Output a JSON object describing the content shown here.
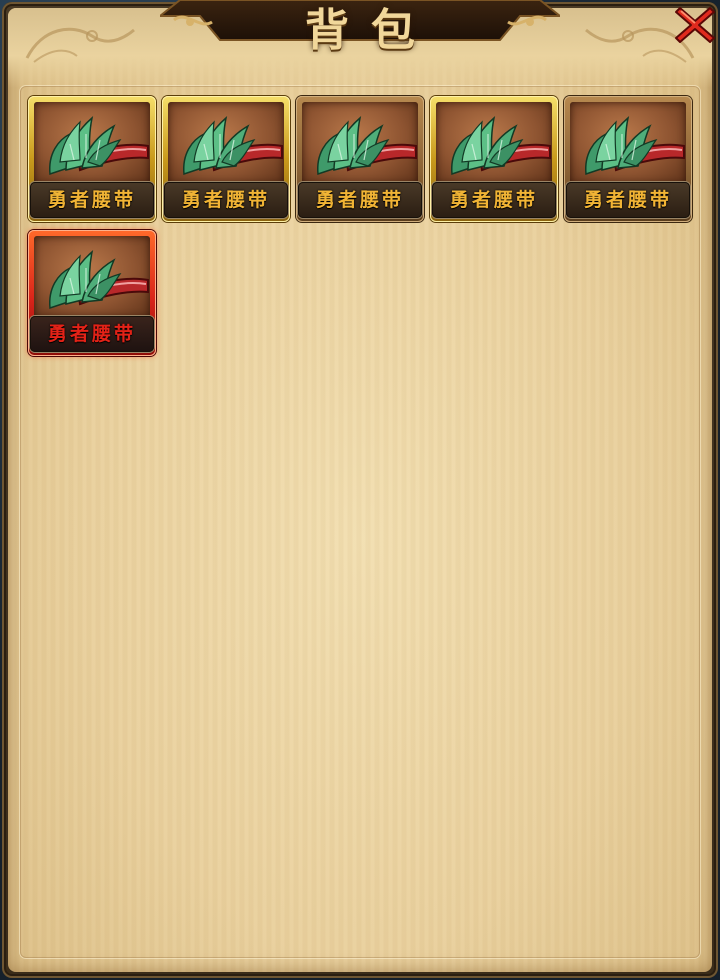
{
  "window": {
    "title": "背包"
  },
  "colors": {
    "parchment": "#e9d09e",
    "frame_dark": "#3a2c19",
    "title_gold": "#f1d79a",
    "name_gold": "#f1b435",
    "name_red": "#e32217",
    "close_red": "#e02a1e"
  },
  "icons": {
    "close": "close-x-icon",
    "item": "jade-belt-icon"
  },
  "inventory": {
    "items": [
      {
        "name": "勇者腰带",
        "quality": "gold"
      },
      {
        "name": "勇者腰带",
        "quality": "gold"
      },
      {
        "name": "勇者腰带",
        "quality": "bronze"
      },
      {
        "name": "勇者腰带",
        "quality": "gold"
      },
      {
        "name": "勇者腰带",
        "quality": "bronze"
      },
      {
        "name": "勇者腰带",
        "quality": "red"
      }
    ]
  }
}
